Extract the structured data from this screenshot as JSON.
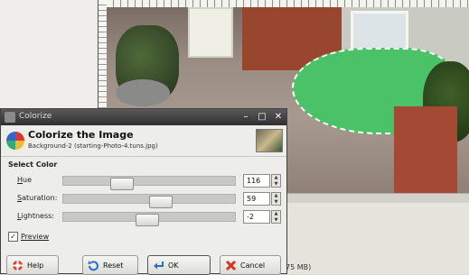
{
  "dialog": {
    "window_title": "Colorize",
    "title": "Colorize the Image",
    "subtitle": "Background-2 (starting-Photo-4.tuns.jpg)",
    "section": "Select Color",
    "sliders": [
      {
        "label_mn": "H",
        "label_rest": "ue",
        "value": "116",
        "fraction": 0.32
      },
      {
        "label_mn": "S",
        "label_rest": "aturation:",
        "value": "59",
        "fraction": 0.58
      },
      {
        "label_mn": "L",
        "label_rest": "ightness:",
        "value": "-2",
        "fraction": 0.49
      }
    ],
    "preview_label": "Preview",
    "preview_checked": true,
    "buttons": {
      "help": "Help",
      "reset": "Reset",
      "ok": "OK",
      "cancel": "Cancel"
    }
  },
  "status": {
    "text": "75 MB)"
  },
  "colors": {
    "selection": "#4cc268",
    "title_bar": "#2f2f31"
  }
}
